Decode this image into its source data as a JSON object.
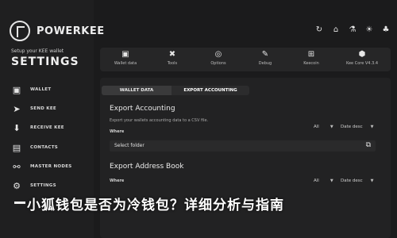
{
  "app": {
    "name": "POWERKEE",
    "setup_text": "Setup your KEE wallet",
    "settings_title": "SETTINGS"
  },
  "sidebar": {
    "items": [
      {
        "label": "WALLET",
        "icon": "wallet-icon"
      },
      {
        "label": "SEND KEE",
        "icon": "send-icon"
      },
      {
        "label": "RECEIVE KEE",
        "icon": "receive-icon"
      },
      {
        "label": "CONTACTS",
        "icon": "contacts-icon"
      },
      {
        "label": "MASTER NODES",
        "icon": "network-icon"
      },
      {
        "label": "SETTINGS",
        "icon": "gear-icon"
      }
    ]
  },
  "top_icons": [
    "refresh-icon",
    "gift-icon",
    "flask-icon",
    "sun-icon",
    "tree-icon"
  ],
  "toolbar": {
    "items": [
      {
        "label": "Wallet data",
        "icon": "wallet-icon"
      },
      {
        "label": "Tools",
        "icon": "tools-icon"
      },
      {
        "label": "Options",
        "icon": "options-icon"
      },
      {
        "label": "Debug",
        "icon": "debug-icon"
      },
      {
        "label": "Keecoin",
        "icon": "keecoin-icon"
      },
      {
        "label": "Kee Core V4.3.4",
        "icon": "core-icon"
      }
    ]
  },
  "tabs": [
    {
      "label": "WALLET DATA"
    },
    {
      "label": "EXPORT ACCOUNTING"
    }
  ],
  "export_accounting": {
    "title": "Export Accounting",
    "subtitle": "Export your wallets accounting data to a CSV file.",
    "where_label": "Where",
    "filter_all": "All",
    "filter_date": "Date desc",
    "select_folder": "Select folder"
  },
  "export_address_book": {
    "title": "Export Address Book",
    "where_label": "Where",
    "filter_all": "All",
    "filter_date": "Date desc"
  },
  "overlay_title": "小狐钱包是否为冷钱包？详细分析与指南",
  "colors": {
    "background": "#1b1b1c",
    "sidebar": "#1f1f20",
    "panel": "#222223",
    "text": "#e6e6e6"
  }
}
